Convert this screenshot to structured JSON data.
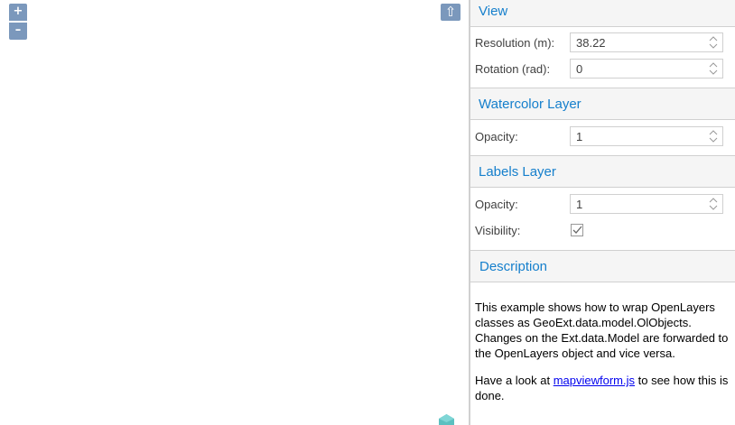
{
  "map": {
    "zoom_in_label": "+",
    "zoom_out_label": "–",
    "rotate_label": "⇧"
  },
  "view": {
    "title": "View",
    "resolution_label": "Resolution (m):",
    "resolution_value": "38.22",
    "rotation_label": "Rotation (rad):",
    "rotation_value": "0"
  },
  "watercolor": {
    "title": "Watercolor Layer",
    "opacity_label": "Opacity:",
    "opacity_value": "1"
  },
  "labels": {
    "title": "Labels Layer",
    "opacity_label": "Opacity:",
    "opacity_value": "1",
    "visibility_label": "Visibility:",
    "visibility_checked": true
  },
  "description": {
    "title": "Description",
    "paragraph1": "This example shows how to wrap OpenLayers classes as GeoExt.data.model.OlObjects. Changes on the Ext.data.Model are forwarded to the OpenLayers object and vice versa.",
    "p2_prefix": "Have a look at ",
    "p2_link": "mapviewform.js",
    "p2_suffix": " to see how this is done."
  },
  "colors": {
    "accent": "#157fcc",
    "control": "#7b98bc",
    "header_bg": "#f5f5f5"
  }
}
